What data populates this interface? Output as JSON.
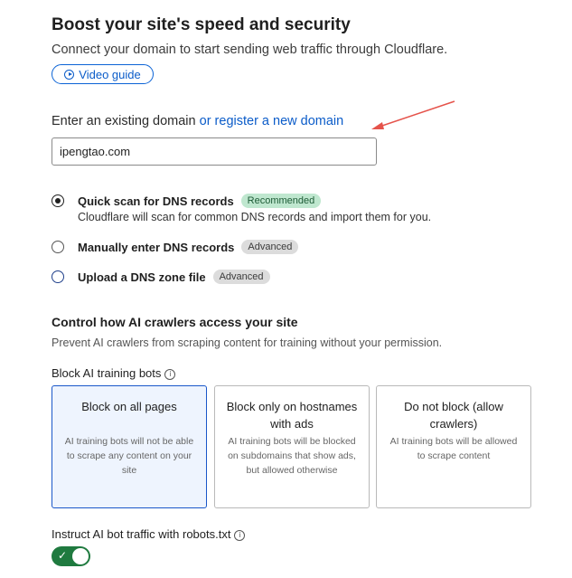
{
  "header": {
    "title": "Boost your site's speed and security",
    "subtitle": "Connect your domain to start sending web traffic through Cloudflare.",
    "video_label": "Video guide"
  },
  "domain": {
    "label": "Enter an existing domain",
    "register_link": "or register a new domain",
    "value": "ipengtao.com"
  },
  "dns_options": [
    {
      "label": "Quick scan for DNS records",
      "badge": "Recommended",
      "description": "Cloudflare will scan for common DNS records and import them for you.",
      "selected": true
    },
    {
      "label": "Manually enter DNS records",
      "badge": "Advanced",
      "selected": false
    },
    {
      "label": "Upload a DNS zone file",
      "badge": "Advanced",
      "selected": false
    }
  ],
  "ai": {
    "heading": "Control how AI crawlers access your site",
    "subheading": "Prevent AI crawlers from scraping content for training without your permission.",
    "block_label": "Block AI training bots",
    "cards": [
      {
        "title": "Block on all pages",
        "desc": "AI training bots will not be able to scrape any content on your site",
        "selected": true
      },
      {
        "title": "Block only on hostnames with ads",
        "desc": "AI training bots will be blocked on subdomains that show ads, but allowed otherwise",
        "selected": false
      },
      {
        "title": "Do not block (allow crawlers)",
        "desc": "AI training bots will be allowed to scrape content",
        "selected": false
      }
    ],
    "robots_label": "Instruct AI bot traffic with robots.txt",
    "robots_enabled": true
  },
  "colors": {
    "accent": "#0b5cc9",
    "toggle_on": "#1f7a3f",
    "arrow": "#e5534b"
  }
}
